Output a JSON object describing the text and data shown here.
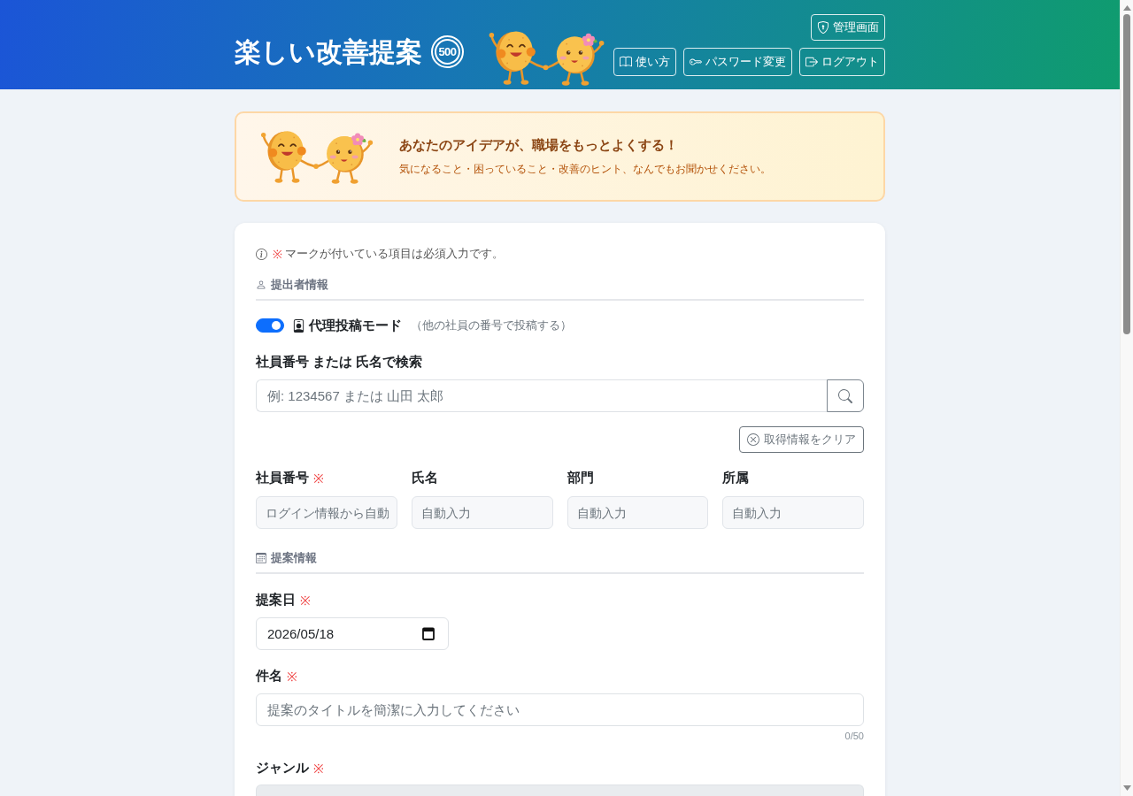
{
  "header": {
    "title": "楽しい改善提案",
    "badge": "500",
    "admin_button": {
      "label": "管理画面"
    },
    "buttons": [
      {
        "kind": "help",
        "label": "使い方"
      },
      {
        "kind": "password",
        "label": "パスワード変更"
      },
      {
        "kind": "logout",
        "label": "ログアウト"
      }
    ]
  },
  "banner": {
    "title": "あなたのアイデアが、職場をもっとよくする！",
    "text": "気になること・困っていること・改善のヒント、なんでもお聞かせください。"
  },
  "form": {
    "required_note": {
      "mark": "※",
      "text": "マークが付いている項目は必須入力です。"
    },
    "submitter_section": {
      "title": "提出者情報",
      "proxy_mode": {
        "label": "代理投稿モード",
        "note": "（他の社員の番号で投稿する）",
        "on": true
      },
      "search": {
        "label": "社員番号 または 氏名で検索",
        "placeholder": "例: 1234567 または 山田 太郎"
      },
      "clear_button": "取得情報をクリア",
      "fields": [
        {
          "label": "社員番号",
          "required_mark": "※",
          "placeholder": "ログイン情報から自動"
        },
        {
          "label": "氏名",
          "placeholder": "自動入力"
        },
        {
          "label": "部門",
          "placeholder": "自動入力"
        },
        {
          "label": "所属",
          "placeholder": "自動入力"
        }
      ]
    },
    "proposal_section": {
      "title": "提案情報",
      "date": {
        "label": "提案日",
        "required_mark": "※",
        "value": "2026/05/18"
      },
      "subject": {
        "label": "件名",
        "required_mark": "※",
        "placeholder": "提案のタイトルを簡潔に入力してください",
        "counter": "0/50"
      },
      "genre": {
        "label": "ジャンル",
        "required_mark": "※",
        "disabled": true
      }
    }
  }
}
